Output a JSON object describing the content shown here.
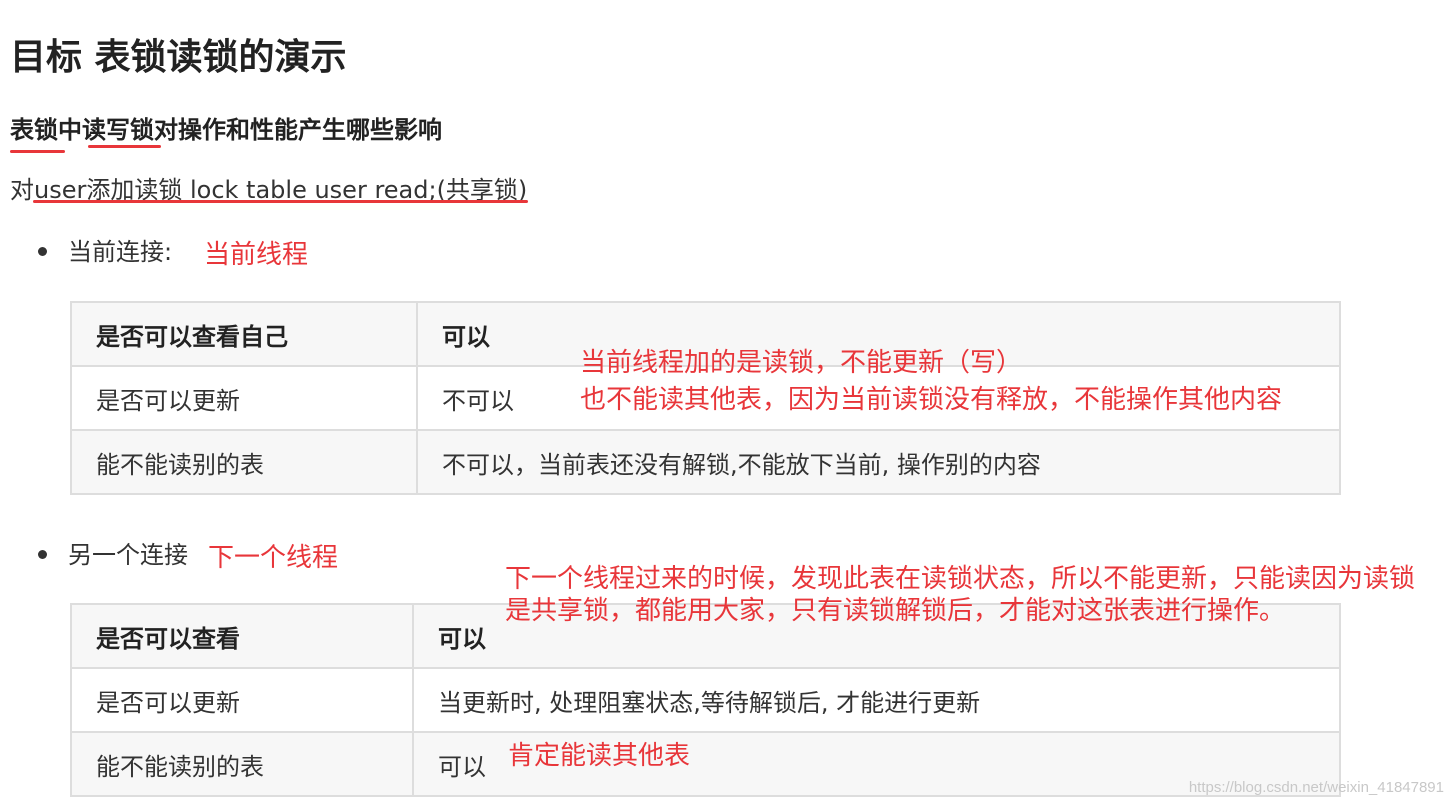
{
  "title": "目标 表锁读锁的演示",
  "subtitle": "表锁中读写锁对操作和性能产生哪些影响",
  "intro": "对user添加读锁 lock table user read;(共享锁)",
  "section1": {
    "bullet": "当前连接:",
    "annotation": "当前线程",
    "note_line1": "当前线程加的是读锁，不能更新（写）",
    "note_line2": "也不能读其他表，因为当前读锁没有释放，不能操作其他内容",
    "table": {
      "header": [
        "是否可以查看自己",
        "可以"
      ],
      "rows": [
        [
          "是否可以更新",
          "不可以"
        ],
        [
          "能不能读别的表",
          "不可以，当前表还没有解锁,不能放下当前, 操作别的内容"
        ]
      ]
    }
  },
  "section2": {
    "bullet": "另一个连接",
    "annotation": "下一个线程",
    "note": "下一个线程过来的时候，发现此表在读锁状态，所以不能更新，只能读因为读锁是共享锁，都能用大家，只有读锁解锁后，才能对这张表进行操作。",
    "extra_note": "肯定能读其他表",
    "table": {
      "header": [
        "是否可以查看",
        "可以"
      ],
      "rows": [
        [
          "是否可以更新",
          "当更新时, 处理阻塞状态,等待解锁后, 才能进行更新"
        ],
        [
          "能不能读别的表",
          "可以"
        ]
      ]
    }
  },
  "watermark": "https://blog.csdn.net/weixin_41847891",
  "colors": {
    "annotation_red": "#e8363a",
    "text": "#333333",
    "table_border": "#dddddd",
    "table_stripe": "#f7f7f7"
  }
}
